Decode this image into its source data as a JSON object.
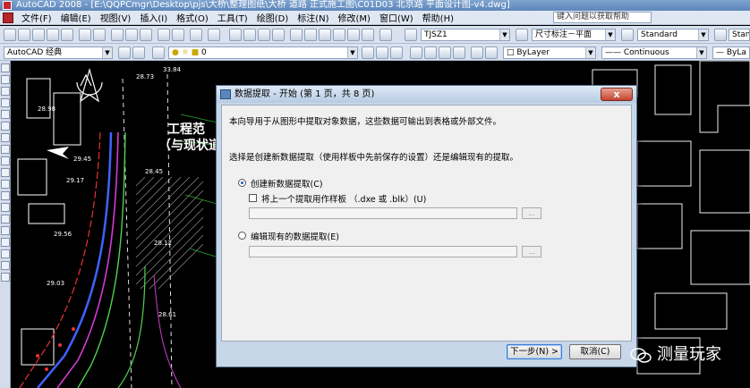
{
  "window": {
    "title": "AutoCAD 2008 - [E:\\QQPCmgr\\Desktop\\pjs\\大桥\\整理图纸\\大桥 道路 正式施工图\\C01D03 北京路 平面设计图-v4.dwg]"
  },
  "menu": {
    "items": [
      "文件(F)",
      "编辑(E)",
      "视图(V)",
      "插入(I)",
      "格式(O)",
      "工具(T)",
      "绘图(D)",
      "标注(N)",
      "修改(M)",
      "窗口(W)",
      "帮助(H)"
    ],
    "help_search_placeholder": "键入问题以获取帮助"
  },
  "toolbar": {
    "text_style": "TJSZ1",
    "dim_style": "尺寸标注－平面",
    "table_style": "Standard",
    "multileader_style": "Standard",
    "workspace": "AutoCAD 经典",
    "layer": "0",
    "color": "ByLayer",
    "linetype": "Continuous",
    "lineweight": "ByLa"
  },
  "drawing": {
    "labels": {
      "project_line1": "工程范",
      "project_line2": "（与现状道路"
    },
    "elevations": [
      "33.84",
      "28.73",
      "28.98",
      "29.45",
      "29.17",
      "28.45",
      "29.56",
      "28.12",
      "29.03",
      "28.61"
    ]
  },
  "dialog": {
    "title": "数据提取 - 开始 (第 1 页，共 8 页)",
    "close_label": "x",
    "intro": "本向导用于从图形中提取对象数据，这些数据可输出到表格或外部文件。",
    "prompt": "选择是创建新数据提取（使用样板中先前保存的设置）还是编辑现有的提取。",
    "option_create": "创建新数据提取(C)",
    "option_use_template": "将上一个提取用作样板 （.dxe 或 .blk）(U)",
    "option_edit_existing": "编辑现有的数据提取(E)",
    "browse_label": "...",
    "next_button": "下一步(N) >",
    "cancel_button": "取消(C)"
  },
  "watermark": {
    "text": "测量玩家"
  },
  "colors": {
    "drawing_background": "#000000",
    "dialog_frame": "#c7d6e8",
    "dialog_body": "#f0f0f0",
    "road_line_blue": "#3f63ff",
    "road_line_magenta": "#d23bd2",
    "road_line_green": "#4fd24f",
    "road_line_red": "#e83232"
  }
}
